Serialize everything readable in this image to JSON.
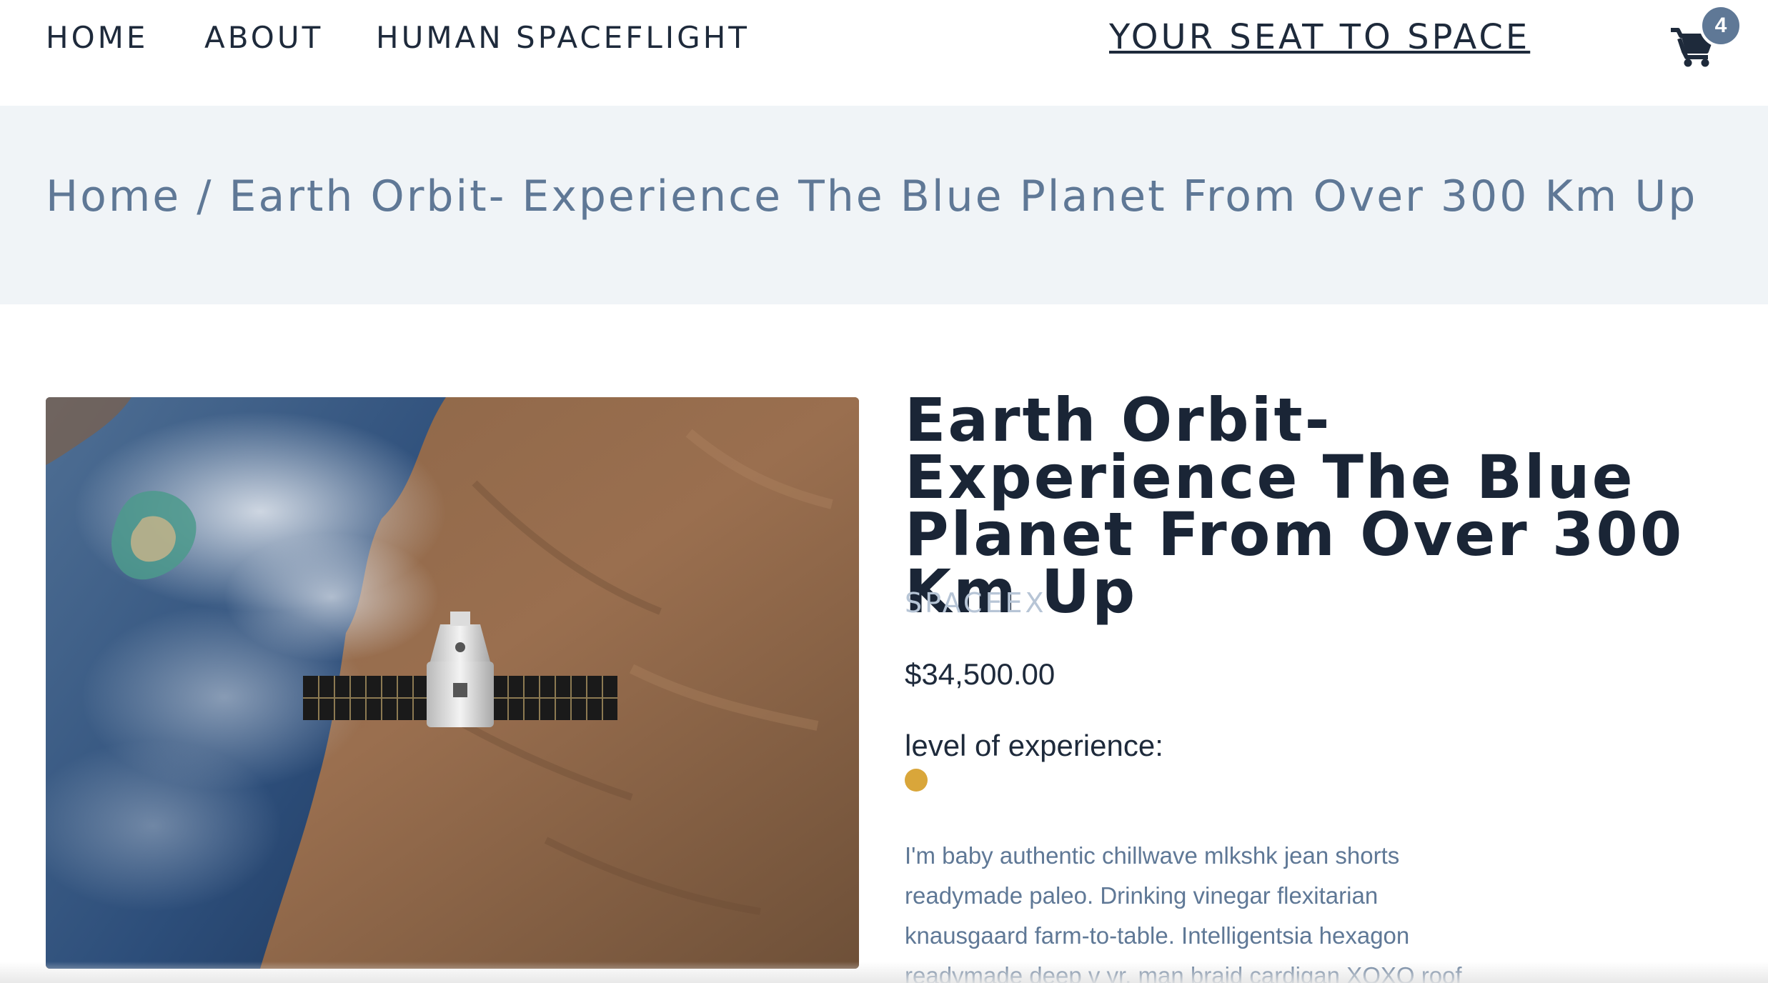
{
  "nav": {
    "links": [
      "HOME",
      "ABOUT",
      "HUMAN SPACEFLIGHT"
    ],
    "brand": "YOUR SEAT TO SPACE",
    "cart_count": "4"
  },
  "breadcrumb": {
    "home": "Home",
    "separator": " / ",
    "current": "Earth Orbit- Experience The Blue Planet From Over 300 Km Up"
  },
  "product": {
    "title": "Earth Orbit- Experience The Blue Planet From Over 300 Km Up",
    "vendor": "SPACEEX",
    "price": "$34,500.00",
    "level_label": "level of experience:",
    "level_color": "#d9a63a",
    "description": "I'm baby authentic chillwave mlkshk jean shorts readymade paleo. Drinking vinegar flexitarian knausgaard farm-to-table. Intelligentsia hexagon readymade deep v yr, man braid cardigan XOXO roof"
  }
}
